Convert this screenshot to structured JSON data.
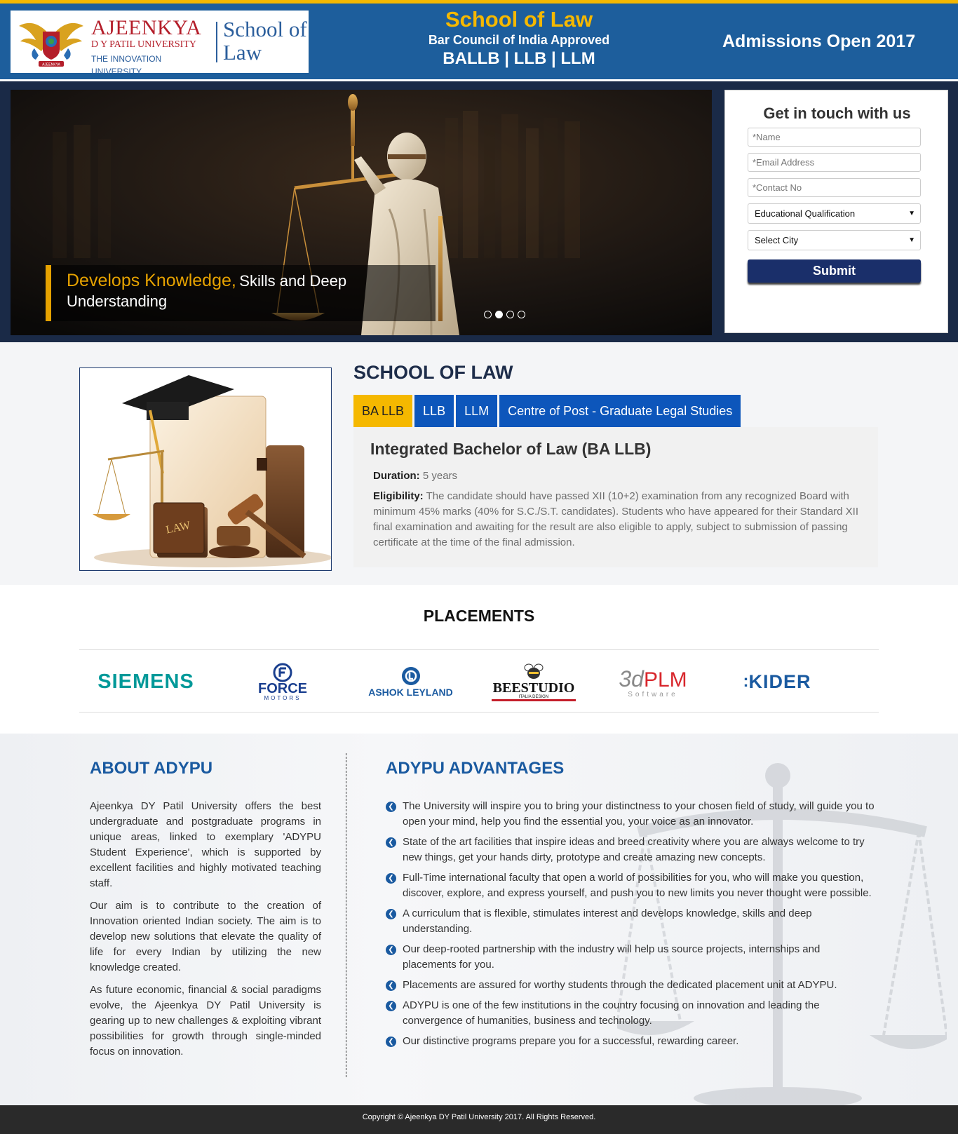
{
  "header": {
    "logo": {
      "university_name": "AJEENKYA",
      "university_sub": "D Y PATIL UNIVERSITY",
      "tagline": "THE INNOVATION UNIVERSITY",
      "school_line1": "School of",
      "school_line2": "Law",
      "crest_text": "AJEENKYA"
    },
    "center_title": "School of Law",
    "center_sub": "Bar Council of India Approved",
    "center_programs": "BALLB | LLB | LLM",
    "right_text": "Admissions Open 2017",
    "colors": {
      "header_bg": "#1d5e9c",
      "accent": "#f5b800"
    }
  },
  "hero": {
    "caption_highlight": "Develops Knowledge,",
    "caption_rest": "Skills and Deep",
    "caption_line2": "Understanding",
    "slides_count": 4,
    "active_slide": 2
  },
  "form": {
    "title": "Get in touch with us",
    "name_placeholder": "*Name",
    "email_placeholder": "*Email Address",
    "contact_placeholder": "*Contact No",
    "qualification_select": "Educational Qualification",
    "city_select": "Select City",
    "submit_label": "Submit"
  },
  "school": {
    "title": "SCHOOL OF LAW",
    "image_label": "LAW",
    "tabs": [
      {
        "label": "BA LLB",
        "active": true
      },
      {
        "label": "LLB",
        "active": false
      },
      {
        "label": "LLM",
        "active": false
      },
      {
        "label": "Centre of Post - Graduate Legal Studies",
        "active": false
      }
    ],
    "panel": {
      "title": "Integrated Bachelor of Law (BA LLB)",
      "duration_label": "Duration:",
      "duration_value": "5 years",
      "eligibility_label": "Eligibility:",
      "eligibility_value": "The candidate should have passed XII (10+2) examination from any recognized Board with minimum 45% marks (40% for S.C./S.T. candidates). Students who have appeared for their Standard XII final examination and awaiting for the result are also eligible to apply, subject to submission of passing certificate at the time of the final admission."
    }
  },
  "placements": {
    "title": "PLACEMENTS",
    "logos": [
      {
        "text": "SIEMENS",
        "color": "#009999"
      },
      {
        "text": "FORCE",
        "sub": "MOTORS",
        "color": "#1a3f8f"
      },
      {
        "text": "ASHOK LEYLAND",
        "color": "#1a5aa0"
      },
      {
        "text": "BEESTUDIO",
        "sub": "ITALIA DESIGN",
        "color": "#111111"
      },
      {
        "text": "3d",
        "text2": "PLM",
        "sub": "Software",
        "color": "#d8262c"
      },
      {
        "text": "KIDER",
        "color": "#1a5aa0"
      }
    ]
  },
  "about": {
    "title": "ABOUT ADYPU",
    "paragraphs": [
      "Ajeenkya DY Patil University offers the best undergraduate and postgraduate programs in unique areas, linked to exemplary 'ADYPU Student Experience', which is supported by excellent facilities and highly motivated teaching staff.",
      "Our aim is to contribute to the creation of Innovation oriented Indian society. The aim is to develop new solutions that elevate the quality of life for every Indian by utilizing the new knowledge created.",
      "As future economic, financial & social paradigms evolve, the Ajeenkya DY Patil University is gearing up to new challenges & exploiting vibrant possibilities for growth through single-minded focus on innovation."
    ]
  },
  "advantages": {
    "title": "ADYPU ADVANTAGES",
    "bullet_icon": "chevron-left-icon",
    "items": [
      "The University will inspire you to bring your distinctness to your chosen field of study, will guide you to open your mind, help you find the essential you, your voice as an innovator.",
      "State of the art facilities that inspire ideas and breed creativity where you are always welcome to try new things, get your hands dirty, prototype and create amazing new concepts.",
      "Full-Time international faculty that open a world of possibilities for you, who will make you question, discover, explore, and express yourself, and push you to new limits you never thought were possible.",
      "A curriculum that is flexible, stimulates interest and develops knowledge, skills and deep understanding.",
      "Our deep-rooted partnership with the industry will help us source projects, internships and placements for you.",
      "Placements are assured for worthy students through the dedicated placement unit at ADYPU.",
      "ADYPU is one of the few institutions in the country focusing on innovation and leading the convergence of humanities, business and technology.",
      "Our distinctive programs prepare you for a successful, rewarding career."
    ]
  },
  "footer": {
    "copyright": "Copyright © Ajeenkya DY Patil University 2017. All Rights Reserved."
  }
}
